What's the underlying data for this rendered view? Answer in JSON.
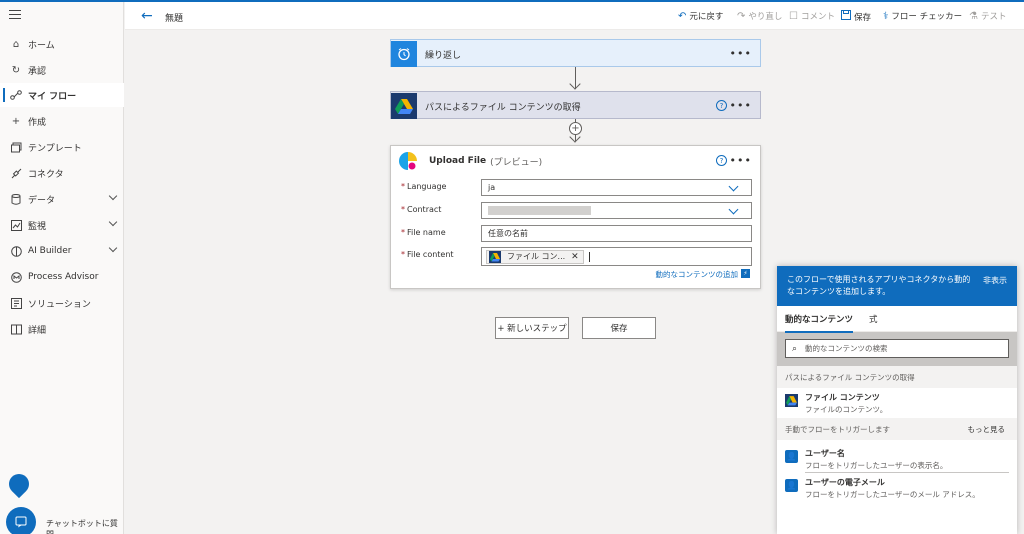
{
  "topbar": {
    "title": "無題",
    "undo": "元に戻す",
    "redo": "やり直し",
    "comment": "コメント",
    "save": "保存",
    "flow_checker": "フロー チェッカー",
    "test": "テスト"
  },
  "sidebar": {
    "items": [
      {
        "label": "ホーム",
        "icon": "home-icon"
      },
      {
        "label": "承認",
        "icon": "approvals-icon"
      },
      {
        "label": "マイ フロー",
        "icon": "flow-icon"
      },
      {
        "label": "作成",
        "icon": "plus-icon"
      },
      {
        "label": "テンプレート",
        "icon": "template-icon"
      },
      {
        "label": "コネクタ",
        "icon": "connector-icon"
      },
      {
        "label": "データ",
        "icon": "database-icon"
      },
      {
        "label": "監視",
        "icon": "monitor-icon"
      },
      {
        "label": "AI Builder",
        "icon": "ai-builder-icon"
      },
      {
        "label": "Process Advisor",
        "icon": "process-advisor-icon"
      },
      {
        "label": "ソリューション",
        "icon": "solution-icon"
      },
      {
        "label": "詳細",
        "icon": "book-icon"
      }
    ],
    "chatbot": "チャットボットに質問"
  },
  "canvas": {
    "step1": {
      "title": "繰り返し"
    },
    "step2": {
      "title": "パスによるファイル コンテンツの取得"
    },
    "step3": {
      "title": "Upload File",
      "title_suffix": "(プレビュー)",
      "fields": {
        "language": {
          "label": "Language",
          "value": "ja"
        },
        "contract": {
          "label": "Contract"
        },
        "file_name": {
          "label": "File name",
          "value": "任意の名前"
        },
        "file_content": {
          "label": "File content",
          "token": "ファイル コン..."
        }
      },
      "add_dynamic": "動的なコンテンツの追加"
    },
    "new_step": "+ 新しいステップ",
    "save": "保存"
  },
  "dynamic_panel": {
    "header": "このフローで使用されるアプリやコネクタから動的なコンテンツを追加します。",
    "hide": "非表示",
    "tabs": [
      "動的なコンテンツ",
      "式"
    ],
    "search_placeholder": "動的なコンテンツの検索",
    "section1": "パスによるファイル コンテンツの取得",
    "item1": {
      "title": "ファイル コンテンツ",
      "desc": "ファイルのコンテンツ。"
    },
    "section2": "手動でフローをトリガーします",
    "more": "もっと見る",
    "item2": {
      "title": "ユーザー名",
      "desc": "フローをトリガーしたユーザーの表示名。"
    },
    "item3": {
      "title": "ユーザーの電子メール",
      "desc": "フローをトリガーしたユーザーのメール アドレス。"
    }
  },
  "colors": {
    "accent": "#0f6cbd"
  }
}
